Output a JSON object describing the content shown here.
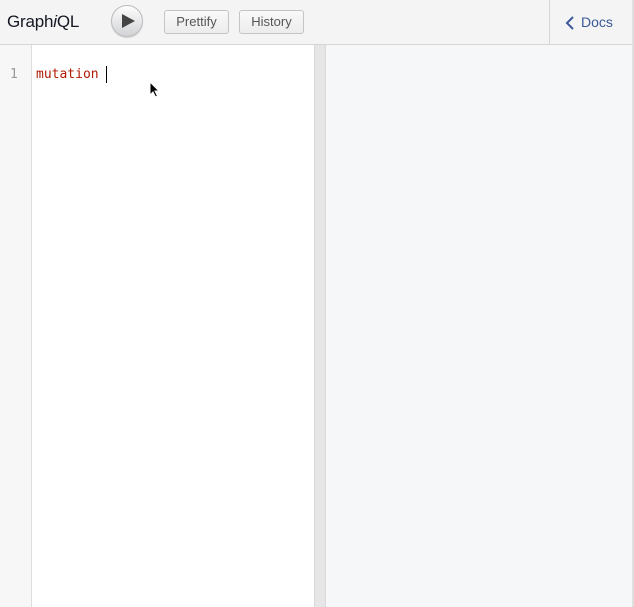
{
  "app": {
    "logo_prefix": "Graph",
    "logo_italic": "i",
    "logo_suffix": "QL"
  },
  "toolbar": {
    "execute_icon": "play-icon",
    "prettify_label": "Prettify",
    "history_label": "History"
  },
  "docs": {
    "icon": "chevron-left-icon",
    "label": "Docs"
  },
  "editor": {
    "line_numbers": [
      "1"
    ],
    "lines": [
      "mutation "
    ]
  },
  "colors": {
    "keyword": "#b11a04",
    "link": "#3b5998"
  }
}
